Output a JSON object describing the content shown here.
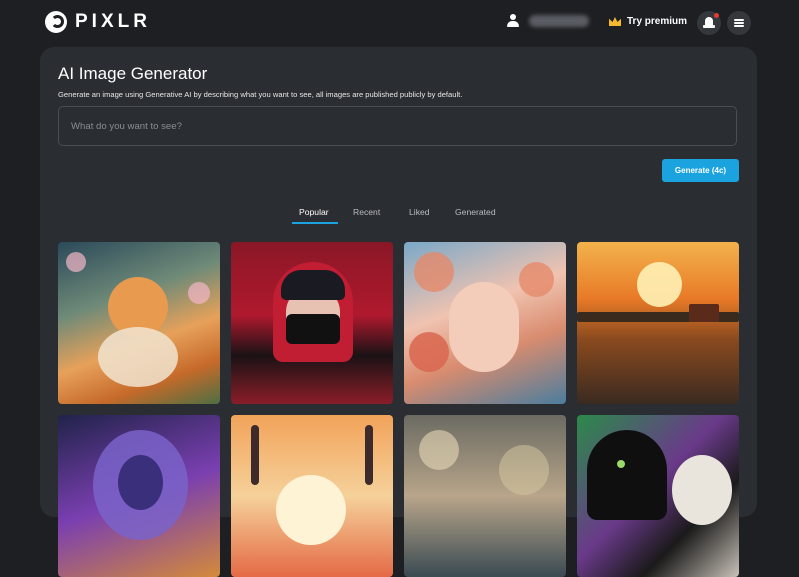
{
  "header": {
    "brand": "PIXLR",
    "premium_label": "Try premium"
  },
  "generator": {
    "title": "AI Image Generator",
    "description": "Generate an image using Generative AI by describing what you want to see, all images are published publicly by default.",
    "prompt_placeholder": "What do you want to see?",
    "generate_label": "Generate (4c)"
  },
  "tabs": [
    {
      "label": "Popular",
      "active": true
    },
    {
      "label": "Recent",
      "active": false
    },
    {
      "label": "Liked",
      "active": false
    },
    {
      "label": "Generated",
      "active": false
    }
  ],
  "gallery": [
    {
      "subject": "cat-with-flowers"
    },
    {
      "subject": "hooded-anime-character"
    },
    {
      "subject": "woman-with-floral-hair"
    },
    {
      "subject": "sunset-lake-cabin"
    },
    {
      "subject": "robot-portrait"
    },
    {
      "subject": "antlers-sunset"
    },
    {
      "subject": "blurred-bokeh"
    },
    {
      "subject": "black-cat-aurora"
    }
  ],
  "colors": {
    "background": "#1d1f22",
    "panel": "#2a2d31",
    "accent": "#1aa3df",
    "crown": "#f5b82e",
    "notification": "#e53935"
  }
}
